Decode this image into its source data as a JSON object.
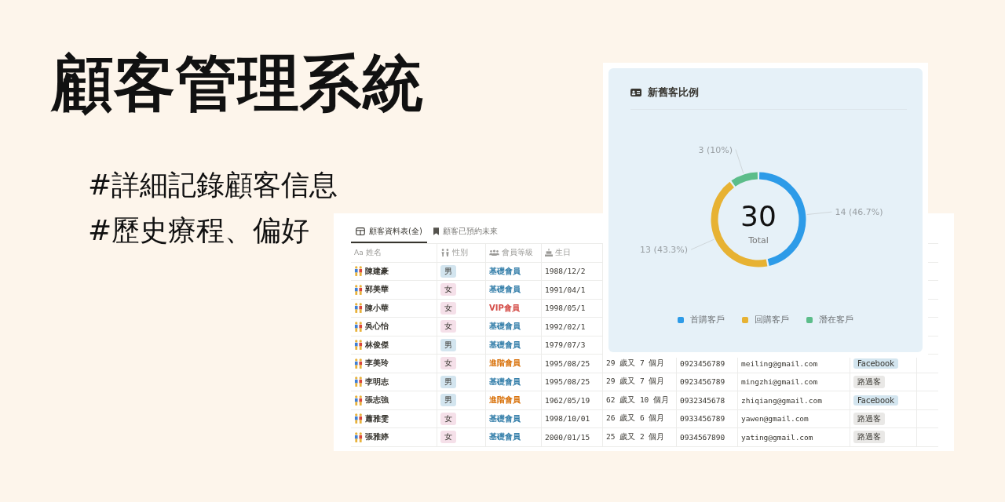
{
  "headline": "顧客管理系統",
  "hashtags": [
    "#詳細記錄顧客信息",
    "#歷史療程、偏好"
  ],
  "table_view": {
    "tabs": [
      {
        "label": "顧客資料表(全)",
        "selected": true
      },
      {
        "label": "顧客已預約未來",
        "selected": false
      }
    ],
    "columns": [
      {
        "label": "姓名",
        "prefix": "Aa"
      },
      {
        "label": "性別"
      },
      {
        "label": "會員等級"
      },
      {
        "label": "生日"
      }
    ],
    "rows": [
      {
        "name": "陳建豪",
        "gender": {
          "text": "男",
          "color": "#d3e5ef"
        },
        "level": {
          "text": "基礎會員",
          "color": "#337ea9"
        },
        "birthday": "1988/12/2"
      },
      {
        "name": "郭美華",
        "gender": {
          "text": "女",
          "color": "#f5e0e9"
        },
        "level": {
          "text": "基礎會員",
          "color": "#337ea9"
        },
        "birthday": "1991/04/1"
      },
      {
        "name": "陳小華",
        "gender": {
          "text": "女",
          "color": "#f5e0e9"
        },
        "level": {
          "text": "VIP會員",
          "color": "#d44c47"
        },
        "birthday": "1998/05/1"
      },
      {
        "name": "吳心怡",
        "gender": {
          "text": "女",
          "color": "#f5e0e9"
        },
        "level": {
          "text": "基礎會員",
          "color": "#337ea9"
        },
        "birthday": "1992/02/1"
      },
      {
        "name": "林俊傑",
        "gender": {
          "text": "男",
          "color": "#d3e5ef"
        },
        "level": {
          "text": "基礎會員",
          "color": "#337ea9"
        },
        "birthday": "1979/07/3"
      },
      {
        "name": "李美玲",
        "gender": {
          "text": "女",
          "color": "#f5e0e9"
        },
        "level": {
          "text": "進階會員",
          "color": "#d9730d"
        },
        "birthday": "1995/08/25",
        "age": "29 歲又 7 個月",
        "phone": "0923456789",
        "email": "meiling@gmail.com",
        "source": {
          "text": "Facebook",
          "color": "#d3e5ef"
        }
      },
      {
        "name": "李明志",
        "gender": {
          "text": "男",
          "color": "#d3e5ef"
        },
        "level": {
          "text": "基礎會員",
          "color": "#337ea9"
        },
        "birthday": "1995/08/25",
        "age": "29 歲又 7 個月",
        "phone": "0923456789",
        "email": "mingzhi@gmail.com",
        "source": {
          "text": "路過客",
          "color": "#e9e8e6"
        }
      },
      {
        "name": "張志強",
        "gender": {
          "text": "男",
          "color": "#d3e5ef"
        },
        "level": {
          "text": "進階會員",
          "color": "#d9730d"
        },
        "birthday": "1962/05/19",
        "age": "62 歲又 10 個月",
        "phone": "0932345678",
        "email": "zhiqiang@gmail.com",
        "source": {
          "text": "Facebook",
          "color": "#d3e5ef"
        }
      },
      {
        "name": "蕭雅雯",
        "gender": {
          "text": "女",
          "color": "#f5e0e9"
        },
        "level": {
          "text": "基礎會員",
          "color": "#337ea9"
        },
        "birthday": "1998/10/01",
        "age": "26 歲又 6 個月",
        "phone": "0933456789",
        "email": "yawen@gmail.com",
        "source": {
          "text": "路過客",
          "color": "#e9e8e6"
        }
      },
      {
        "name": "張雅婷",
        "gender": {
          "text": "女",
          "color": "#f5e0e9"
        },
        "level": {
          "text": "基礎會員",
          "color": "#337ea9"
        },
        "birthday": "2000/01/15",
        "age": "25 歲又 2 個月",
        "phone": "0934567890",
        "email": "yating@gmail.com",
        "source": {
          "text": "路過客",
          "color": "#e9e8e6"
        }
      }
    ]
  },
  "chart_panel": {
    "title": "新舊客比例",
    "center_value": "30",
    "center_label": "Total",
    "chart_data": {
      "type": "donut",
      "categories": [
        "首購客戶",
        "回購客戶",
        "潛在客戶"
      ],
      "values": [
        14,
        13,
        3
      ],
      "colors": [
        "#2d9be8",
        "#e7b233",
        "#5cbd8a"
      ],
      "value_labels": [
        "14 (46.7%)",
        "13 (43.3%)",
        "3 (10%)"
      ],
      "legend": "bottom"
    }
  }
}
